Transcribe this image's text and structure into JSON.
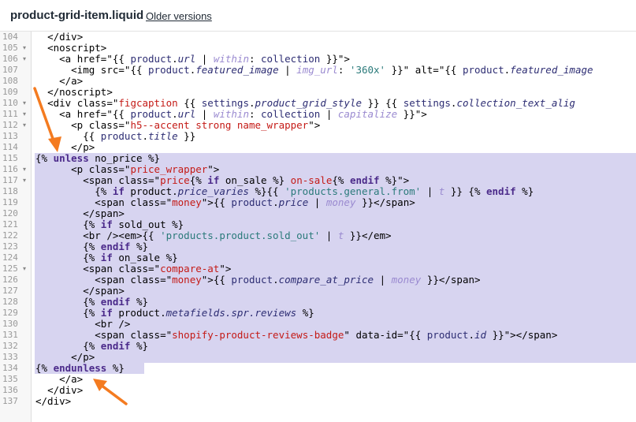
{
  "header": {
    "file_title": "product-grid-item.liquid",
    "older_versions_label": "Older versions"
  },
  "icons": {
    "fold_icon": "triangle-down",
    "arrow_icon": "annotation-arrow"
  },
  "colors": {
    "selection": "#d7d4f0",
    "arrow": "#f47b20",
    "keyword": "#4b2a8a",
    "string": "#c41a16"
  },
  "editor": {
    "lines": [
      {
        "n": "104",
        "fold": false,
        "sel": false,
        "indent": "  ",
        "tokens": [
          [
            "punc",
            "</div>"
          ]
        ]
      },
      {
        "n": "105",
        "fold": true,
        "sel": false,
        "indent": "  ",
        "tokens": [
          [
            "punc",
            "<noscript>"
          ]
        ]
      },
      {
        "n": "106",
        "fold": true,
        "sel": false,
        "indent": "    ",
        "tokens": [
          [
            "punc",
            "<a "
          ],
          [
            "attr",
            "href"
          ],
          [
            "punc",
            "=\""
          ],
          [
            "punc",
            "{{ "
          ],
          [
            "var",
            "product"
          ],
          [
            "punc",
            "."
          ],
          [
            "prop",
            "url"
          ],
          [
            "punc",
            " | "
          ],
          [
            "filter",
            "within"
          ],
          [
            "punc",
            ": "
          ],
          [
            "var",
            "collection"
          ],
          [
            "punc",
            " }}"
          ],
          [
            "punc",
            "\">"
          ]
        ]
      },
      {
        "n": "107",
        "fold": false,
        "sel": false,
        "indent": "      ",
        "tokens": [
          [
            "punc",
            "<img "
          ],
          [
            "attr",
            "src"
          ],
          [
            "punc",
            "=\""
          ],
          [
            "punc",
            "{{ "
          ],
          [
            "var",
            "product"
          ],
          [
            "punc",
            "."
          ],
          [
            "prop",
            "featured_image"
          ],
          [
            "punc",
            " | "
          ],
          [
            "filter",
            "img_url"
          ],
          [
            "punc",
            ": "
          ],
          [
            "lstr",
            "'360x'"
          ],
          [
            "punc",
            " }}"
          ],
          [
            "punc",
            "\" "
          ],
          [
            "attr",
            "alt"
          ],
          [
            "punc",
            "=\"{{ "
          ],
          [
            "var",
            "product"
          ],
          [
            "punc",
            "."
          ],
          [
            "prop",
            "featured_image"
          ]
        ]
      },
      {
        "n": "108",
        "fold": false,
        "sel": false,
        "indent": "    ",
        "tokens": [
          [
            "punc",
            "</a>"
          ]
        ]
      },
      {
        "n": "109",
        "fold": false,
        "sel": false,
        "indent": "  ",
        "tokens": [
          [
            "punc",
            "</noscript>"
          ]
        ]
      },
      {
        "n": "110",
        "fold": true,
        "sel": false,
        "indent": "  ",
        "tokens": [
          [
            "punc",
            "<div "
          ],
          [
            "attr",
            "class"
          ],
          [
            "punc",
            "=\""
          ],
          [
            "str",
            "figcaption "
          ],
          [
            "punc",
            "{{ "
          ],
          [
            "var",
            "settings"
          ],
          [
            "punc",
            "."
          ],
          [
            "prop",
            "product_grid_style"
          ],
          [
            "punc",
            " }} {{ "
          ],
          [
            "var",
            "settings"
          ],
          [
            "punc",
            "."
          ],
          [
            "prop",
            "collection_text_alig"
          ]
        ]
      },
      {
        "n": "111",
        "fold": true,
        "sel": false,
        "indent": "    ",
        "tokens": [
          [
            "punc",
            "<a "
          ],
          [
            "attr",
            "href"
          ],
          [
            "punc",
            "=\"{{ "
          ],
          [
            "var",
            "product"
          ],
          [
            "punc",
            "."
          ],
          [
            "prop",
            "url"
          ],
          [
            "punc",
            " | "
          ],
          [
            "filter",
            "within"
          ],
          [
            "punc",
            ": "
          ],
          [
            "var",
            "collection"
          ],
          [
            "punc",
            " | "
          ],
          [
            "filter",
            "capitalize"
          ],
          [
            "punc",
            " }}\">"
          ]
        ]
      },
      {
        "n": "112",
        "fold": true,
        "sel": false,
        "indent": "      ",
        "tokens": [
          [
            "punc",
            "<p "
          ],
          [
            "attr",
            "class"
          ],
          [
            "punc",
            "=\""
          ],
          [
            "str",
            "h5--accent strong name_wrapper"
          ],
          [
            "punc",
            "\">"
          ]
        ]
      },
      {
        "n": "113",
        "fold": false,
        "sel": false,
        "indent": "        ",
        "tokens": [
          [
            "punc",
            "{{ "
          ],
          [
            "var",
            "product"
          ],
          [
            "punc",
            "."
          ],
          [
            "prop",
            "title"
          ],
          [
            "punc",
            " }}"
          ]
        ]
      },
      {
        "n": "114",
        "fold": false,
        "sel": false,
        "indent": "      ",
        "tokens": [
          [
            "punc",
            "</p>"
          ]
        ]
      },
      {
        "n": "115",
        "fold": false,
        "sel": true,
        "indent": "",
        "tokens": [
          [
            "punc",
            "{% "
          ],
          [
            "kw",
            "unless"
          ],
          [
            "text",
            " no_price "
          ],
          [
            "punc",
            "%}"
          ]
        ]
      },
      {
        "n": "116",
        "fold": true,
        "sel": true,
        "indent": "      ",
        "tokens": [
          [
            "punc",
            "<p "
          ],
          [
            "attr",
            "class"
          ],
          [
            "punc",
            "=\""
          ],
          [
            "str",
            "price_wrapper"
          ],
          [
            "punc",
            "\">"
          ]
        ]
      },
      {
        "n": "117",
        "fold": true,
        "sel": true,
        "indent": "        ",
        "tokens": [
          [
            "punc",
            "<span "
          ],
          [
            "attr",
            "class"
          ],
          [
            "punc",
            "=\""
          ],
          [
            "str",
            "price"
          ],
          [
            "punc",
            "{% "
          ],
          [
            "kw",
            "if"
          ],
          [
            "text",
            " on_sale "
          ],
          [
            "punc",
            "%} "
          ],
          [
            "str",
            "on-sale"
          ],
          [
            "punc",
            "{% "
          ],
          [
            "kw",
            "endif"
          ],
          [
            "punc",
            " %}\">"
          ]
        ]
      },
      {
        "n": "118",
        "fold": false,
        "sel": true,
        "indent": "          ",
        "tokens": [
          [
            "punc",
            "{% "
          ],
          [
            "kw",
            "if"
          ],
          [
            "text",
            " product."
          ],
          [
            "prop",
            "price_varies"
          ],
          [
            "punc",
            " %}{{ "
          ],
          [
            "lstr",
            "'products.general.from'"
          ],
          [
            "punc",
            " | "
          ],
          [
            "filter",
            "t"
          ],
          [
            "punc",
            " }} {% "
          ],
          [
            "kw",
            "endif"
          ],
          [
            "punc",
            " %}"
          ]
        ]
      },
      {
        "n": "119",
        "fold": false,
        "sel": true,
        "indent": "          ",
        "tokens": [
          [
            "punc",
            "<span "
          ],
          [
            "attr",
            "class"
          ],
          [
            "punc",
            "=\""
          ],
          [
            "str",
            "money"
          ],
          [
            "punc",
            "\">{{ "
          ],
          [
            "var",
            "product"
          ],
          [
            "punc",
            "."
          ],
          [
            "prop",
            "price"
          ],
          [
            "punc",
            " | "
          ],
          [
            "filter",
            "money"
          ],
          [
            "punc",
            " }}</span>"
          ]
        ]
      },
      {
        "n": "120",
        "fold": false,
        "sel": true,
        "indent": "        ",
        "tokens": [
          [
            "punc",
            "</span>"
          ]
        ]
      },
      {
        "n": "121",
        "fold": false,
        "sel": true,
        "indent": "        ",
        "tokens": [
          [
            "punc",
            "{% "
          ],
          [
            "kw",
            "if"
          ],
          [
            "text",
            " sold_out "
          ],
          [
            "punc",
            "%}"
          ]
        ]
      },
      {
        "n": "122",
        "fold": false,
        "sel": true,
        "indent": "        ",
        "tokens": [
          [
            "punc",
            "<br /><em>{{ "
          ],
          [
            "lstr",
            "'products.product.sold_out'"
          ],
          [
            "punc",
            " | "
          ],
          [
            "filter",
            "t"
          ],
          [
            "punc",
            " }}</em>"
          ]
        ]
      },
      {
        "n": "123",
        "fold": false,
        "sel": true,
        "indent": "        ",
        "tokens": [
          [
            "punc",
            "{% "
          ],
          [
            "kw",
            "endif"
          ],
          [
            "punc",
            " %}"
          ]
        ]
      },
      {
        "n": "124",
        "fold": false,
        "sel": true,
        "indent": "        ",
        "tokens": [
          [
            "punc",
            "{% "
          ],
          [
            "kw",
            "if"
          ],
          [
            "text",
            " on_sale "
          ],
          [
            "punc",
            "%}"
          ]
        ]
      },
      {
        "n": "125",
        "fold": true,
        "sel": true,
        "indent": "        ",
        "tokens": [
          [
            "punc",
            "<span "
          ],
          [
            "attr",
            "class"
          ],
          [
            "punc",
            "=\""
          ],
          [
            "str",
            "compare-at"
          ],
          [
            "punc",
            "\">"
          ]
        ]
      },
      {
        "n": "126",
        "fold": false,
        "sel": true,
        "indent": "          ",
        "tokens": [
          [
            "punc",
            "<span "
          ],
          [
            "attr",
            "class"
          ],
          [
            "punc",
            "=\""
          ],
          [
            "str",
            "money"
          ],
          [
            "punc",
            "\">{{ "
          ],
          [
            "var",
            "product"
          ],
          [
            "punc",
            "."
          ],
          [
            "prop",
            "compare_at_price"
          ],
          [
            "punc",
            " | "
          ],
          [
            "filter",
            "money"
          ],
          [
            "punc",
            " }}</span>"
          ]
        ]
      },
      {
        "n": "127",
        "fold": false,
        "sel": true,
        "indent": "        ",
        "tokens": [
          [
            "punc",
            "</span>"
          ]
        ]
      },
      {
        "n": "128",
        "fold": false,
        "sel": true,
        "indent": "        ",
        "tokens": [
          [
            "punc",
            "{% "
          ],
          [
            "kw",
            "endif"
          ],
          [
            "punc",
            " %}"
          ]
        ]
      },
      {
        "n": "129",
        "fold": false,
        "sel": true,
        "indent": "        ",
        "tokens": [
          [
            "punc",
            "{% "
          ],
          [
            "kw",
            "if"
          ],
          [
            "text",
            " product."
          ],
          [
            "prop",
            "metafields.spr.reviews"
          ],
          [
            "punc",
            " %}"
          ]
        ]
      },
      {
        "n": "130",
        "fold": false,
        "sel": true,
        "indent": "          ",
        "tokens": [
          [
            "punc",
            "<br />"
          ]
        ]
      },
      {
        "n": "131",
        "fold": false,
        "sel": true,
        "indent": "          ",
        "tokens": [
          [
            "punc",
            "<span "
          ],
          [
            "attr",
            "class"
          ],
          [
            "punc",
            "=\""
          ],
          [
            "str",
            "shopify-product-reviews-badge"
          ],
          [
            "punc",
            "\" "
          ],
          [
            "attr",
            "data-id"
          ],
          [
            "punc",
            "=\"{{ "
          ],
          [
            "var",
            "product"
          ],
          [
            "punc",
            "."
          ],
          [
            "prop",
            "id"
          ],
          [
            "punc",
            " }}\"></span>"
          ]
        ]
      },
      {
        "n": "132",
        "fold": false,
        "sel": true,
        "indent": "        ",
        "tokens": [
          [
            "punc",
            "{% "
          ],
          [
            "kw",
            "endif"
          ],
          [
            "punc",
            " %}"
          ]
        ]
      },
      {
        "n": "133",
        "fold": false,
        "sel": true,
        "indent": "      ",
        "tokens": [
          [
            "punc",
            "</p>"
          ]
        ]
      },
      {
        "n": "134",
        "fold": false,
        "sel": true,
        "indent": "",
        "tokens": [
          [
            "punc",
            "{% "
          ],
          [
            "kw",
            "endunless"
          ],
          [
            "punc",
            " %}"
          ]
        ]
      },
      {
        "n": "135",
        "fold": false,
        "sel": false,
        "indent": "    ",
        "tokens": [
          [
            "punc",
            "</a>"
          ]
        ]
      },
      {
        "n": "136",
        "fold": false,
        "sel": false,
        "indent": "  ",
        "tokens": [
          [
            "punc",
            "</div>"
          ]
        ]
      },
      {
        "n": "137",
        "fold": false,
        "sel": false,
        "indent": "",
        "tokens": [
          [
            "punc",
            "</div>"
          ]
        ]
      }
    ]
  }
}
